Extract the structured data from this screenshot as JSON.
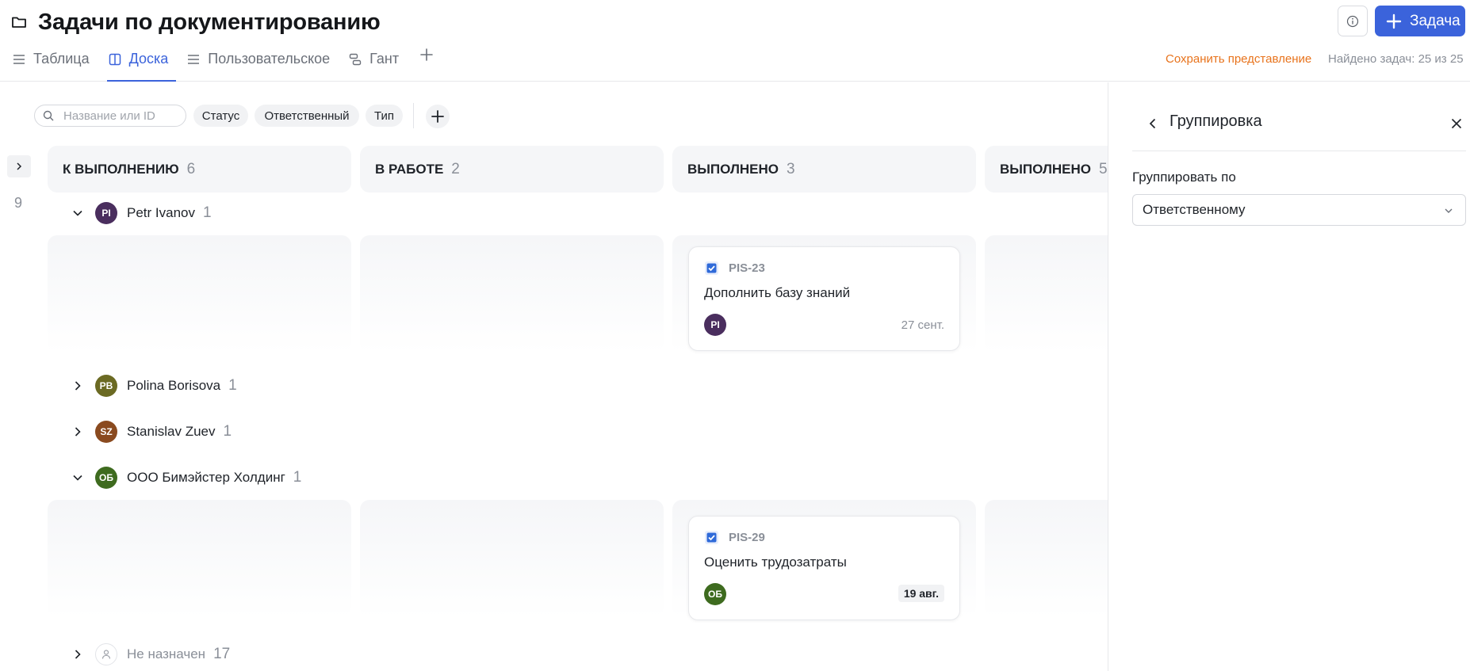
{
  "header": {
    "title": "Задачи по документированию",
    "add_task_label": "Задача",
    "save_view_label": "Сохранить представление",
    "found_text": "Найдено задач: 25 из 25"
  },
  "tabs": [
    {
      "label": "Таблица",
      "icon": "list-icon",
      "active": false
    },
    {
      "label": "Доска",
      "icon": "board-icon",
      "active": true
    },
    {
      "label": "Пользовательское",
      "icon": "list-icon",
      "active": false
    },
    {
      "label": "Гант",
      "icon": "gantt-icon",
      "active": false
    }
  ],
  "filters": {
    "search_placeholder": "Название или ID",
    "chips": [
      "Статус",
      "Ответственный",
      "Тип"
    ]
  },
  "left_count": "9",
  "columns": [
    {
      "name": "К ВЫПОЛНЕНИЮ",
      "count": "6"
    },
    {
      "name": "В РАБОТЕ",
      "count": "2"
    },
    {
      "name": "ВЫПОЛНЕНО",
      "count": "3"
    },
    {
      "name": "ВЫПОЛНЕНО",
      "count": "5"
    }
  ],
  "groups": [
    {
      "name": "Petr Ivanov",
      "initials": "PI",
      "count": "1",
      "expanded": true,
      "color": "#4a2e5e"
    },
    {
      "name": "Polina Borisova",
      "initials": "PB",
      "count": "1",
      "expanded": false,
      "color": "#6b6a23"
    },
    {
      "name": "Stanislav Zuev",
      "initials": "SZ",
      "count": "1",
      "expanded": false,
      "color": "#8a4a1f"
    },
    {
      "name": "ООО Бимэйстер Холдинг",
      "initials": "ОБ",
      "count": "1",
      "expanded": true,
      "color": "#3e6b1f"
    },
    {
      "name": "Не назначен",
      "initials": "",
      "count": "17",
      "expanded": false,
      "color": "#ffffff"
    }
  ],
  "cards": [
    {
      "id": "PIS-23",
      "title": "Дополнить базу знаний",
      "initials": "PI",
      "date": "27 сент.",
      "date_badge": false
    },
    {
      "id": "PIS-29",
      "title": "Оценить трудозатраты",
      "initials": "ОБ",
      "date": "19 авг.",
      "date_badge": true
    }
  ],
  "panel": {
    "title": "Группировка",
    "label": "Группировать по",
    "select_value": "Ответственному"
  },
  "colors": {
    "accent": "#3b63db",
    "save_view": "#e8731c"
  }
}
